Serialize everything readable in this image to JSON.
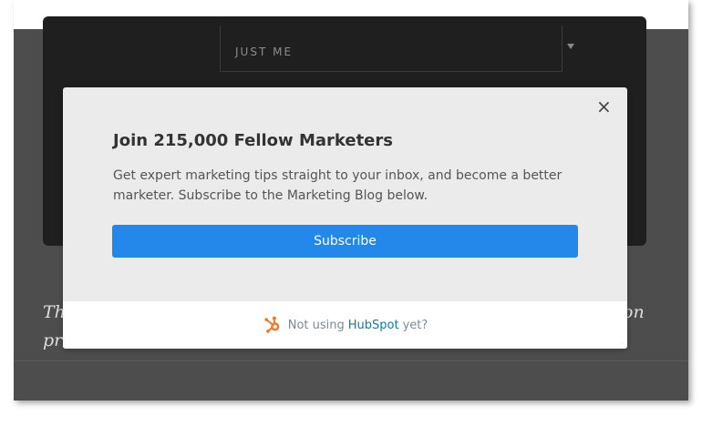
{
  "background": {
    "select_value": "JUST ME",
    "text_line_1_left": "Th",
    "text_line_1_right": "on",
    "text_line_2_left": "pr",
    "colors": {
      "page_bg": "#4d4d4d",
      "card_bg": "#1f1f1f"
    }
  },
  "modal": {
    "close_icon": "×",
    "title": "Join 215,000 Fellow Marketers",
    "description": "Get expert marketing tips straight to your inbox, and become a better marketer. Subscribe to the Marketing Blog below.",
    "subscribe_label": "Subscribe",
    "footer": {
      "icon": "hubspot-sprocket-icon",
      "prefix": "Not using",
      "brand": "HubSpot",
      "suffix": "yet?"
    },
    "colors": {
      "button": "#2488ea",
      "brand_text": "#0f7ca3",
      "sprocket": "#f57722"
    }
  }
}
